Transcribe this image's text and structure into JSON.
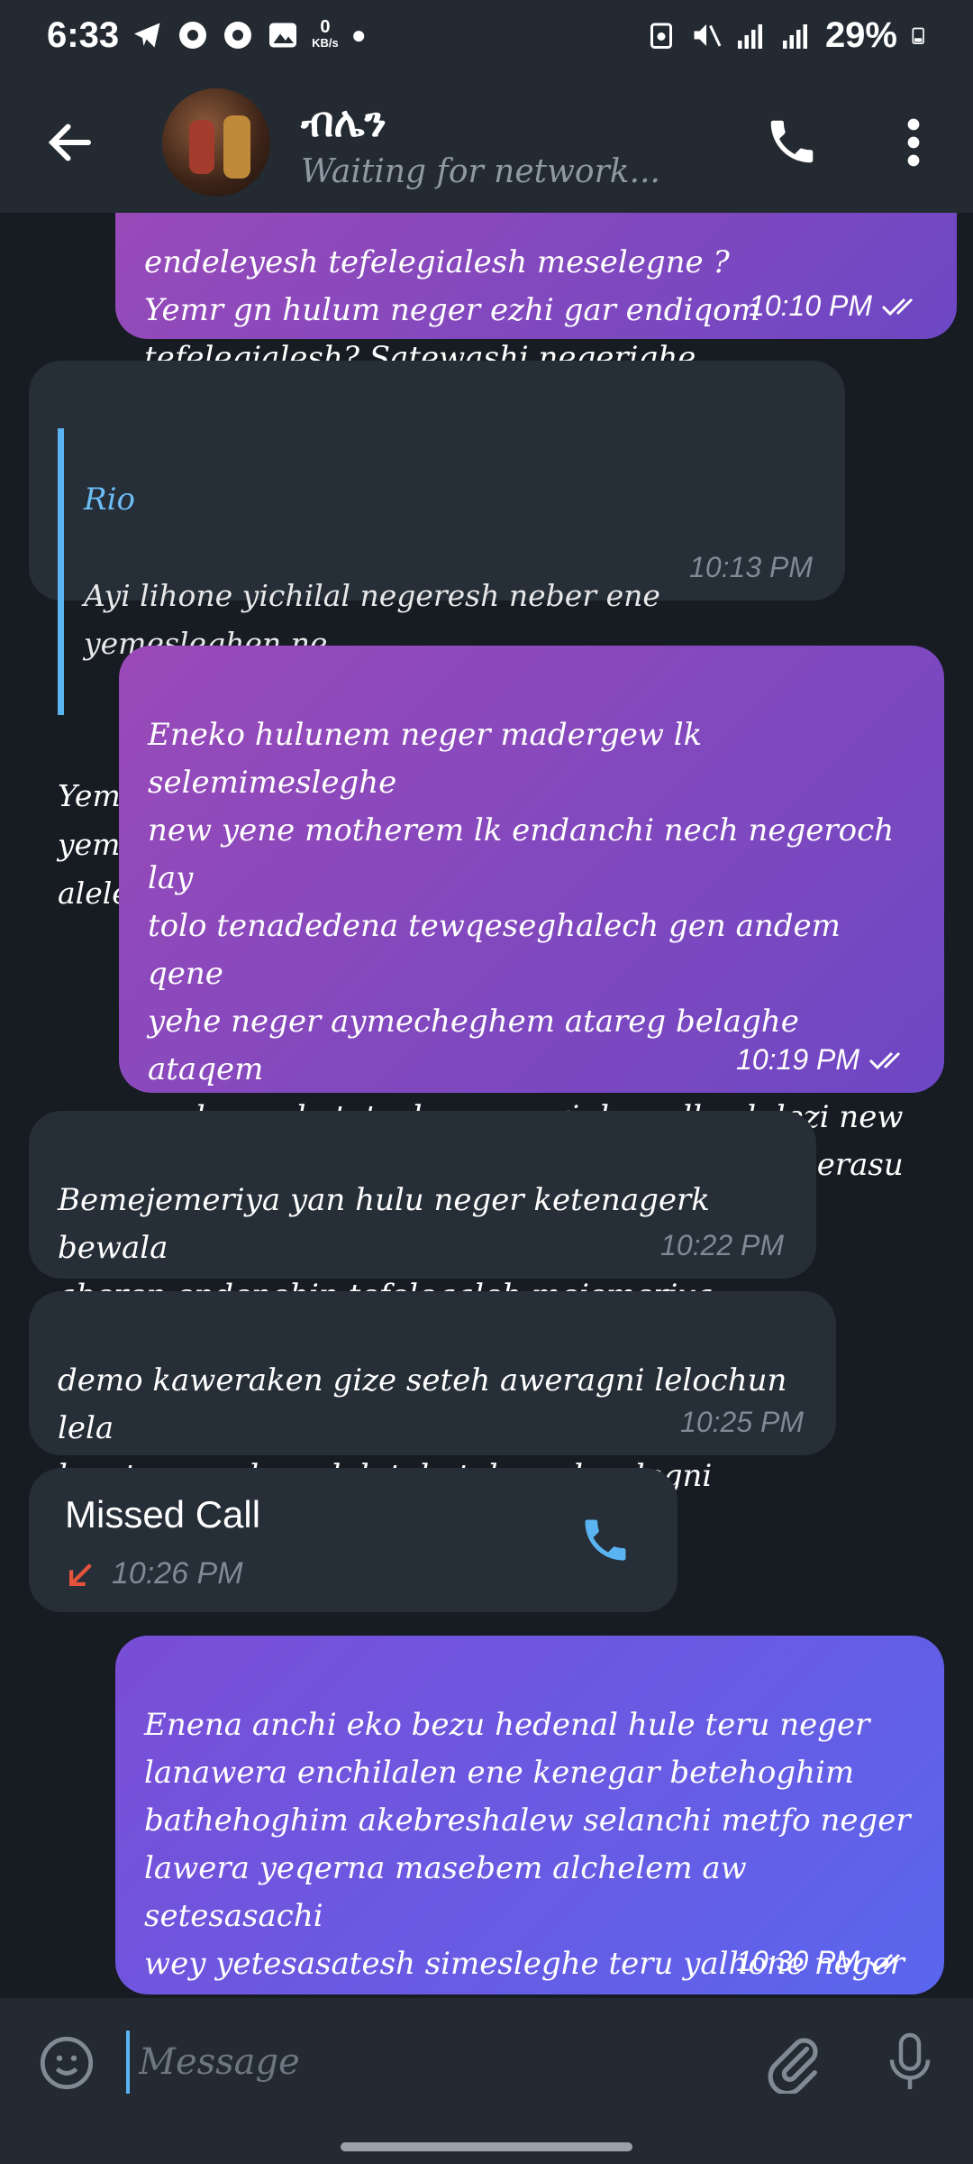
{
  "status_bar": {
    "time": "6:33",
    "net_speed_value": "0",
    "net_speed_unit": "KB/s",
    "battery": "29%"
  },
  "header": {
    "contact_name": "ብሌን",
    "status": "Waiting for network..."
  },
  "messages": [
    {
      "direction": "out",
      "text": "endeleyesh tefelegialesh meselegne ?\nYemr gn hulum neger ezhi gar endiqom\ntefelegialesh? Satewashi negerighe",
      "time": "10:10 PM"
    },
    {
      "direction": "in",
      "reply_to_name": "Rio",
      "reply_to_text": "Ayi lihone yichilal negeresh neber ene yemesleghen ne...",
      "text": "Yemateredagni wesanewochen bechahn\nyemetewesen kehone aw ezi gar biqom mnm alelem",
      "time": "10:13 PM"
    },
    {
      "direction": "out",
      "text": "Eneko hulunem neger madergew lk selemimesleghe\nnew yene motherem lk endanchi nech negeroch lay\ntolo tenadedena tewqeseghalech gen andem qene\nyehe neger aymecheghem atareg belaghe ataqem\nqedem sehetetochen negerighe yalkush lezi new\nahun negeroch be fetari feqad bistekakelu erasu\nmn mareg endalebeghe ena endelilebeghe alaqem so\nyehe neger aymecheghem atareg beyighe",
      "time": "10:19 PM"
    },
    {
      "direction": "in",
      "text": "Bemejemeriya yan hulu neger ketenagerk bewala\naberen endenehin tefelegaleh mejemeriya yihen\nmeleselegni",
      "time": "10:22 PM"
    },
    {
      "direction": "in",
      "text": "demo kaweraken gize seteh aweragni lelochun lela\nken tawerachewaleh tolo tolo meleselegni enkelfe\neyemeta new",
      "time": "10:25 PM"
    },
    {
      "direction": "out",
      "text": "Enena anchi eko bezu hedenal hule teru neger\nlanawera enchilalen ene kenegar betehoghim\nbathehoghim akebreshalew selanchi metfo neger\nlawera yeqerna masebem alchelem aw setesasachi\nwey yetesasatesh simesleghe teru yalhone neger\ntenagere aqalew gen tesadebe alaqem demo senaded\nyetenagerkut neger kalem afu beyighe",
      "time": "10:30 PM"
    }
  ],
  "missed_call": {
    "title": "Missed Call",
    "time": "10:26 PM"
  },
  "input": {
    "placeholder": "Message"
  },
  "colors": {
    "accent": "#5ab4f2",
    "outgoing_start": "#9a4ab8",
    "outgoing_end": "#6d47c4",
    "incoming": "#262e37",
    "missed": "#e5533d"
  }
}
